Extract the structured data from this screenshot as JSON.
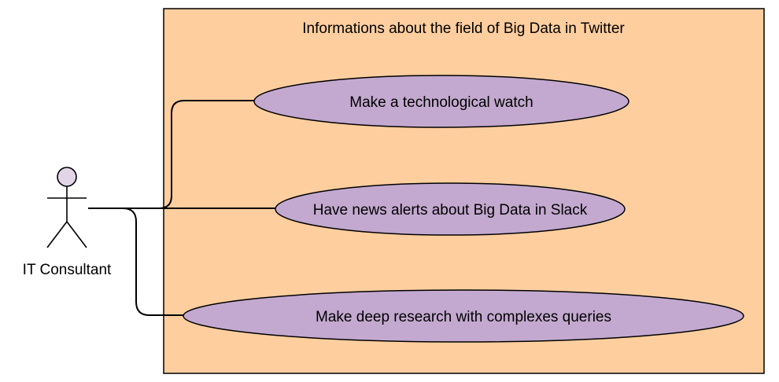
{
  "diagram": {
    "system_title": "Informations about the field of Big Data in Twitter",
    "actor": {
      "label": "IT Consultant"
    },
    "use_cases": [
      {
        "label": "Make a technological watch"
      },
      {
        "label": "Have news alerts about Big Data in Slack"
      },
      {
        "label": "Make deep research with complexes queries"
      }
    ],
    "colors": {
      "system_fill": "#FFCE9F",
      "use_case_fill": "#C3A9CF",
      "actor_fill": "#E1D5E7",
      "stroke": "#000000"
    }
  }
}
